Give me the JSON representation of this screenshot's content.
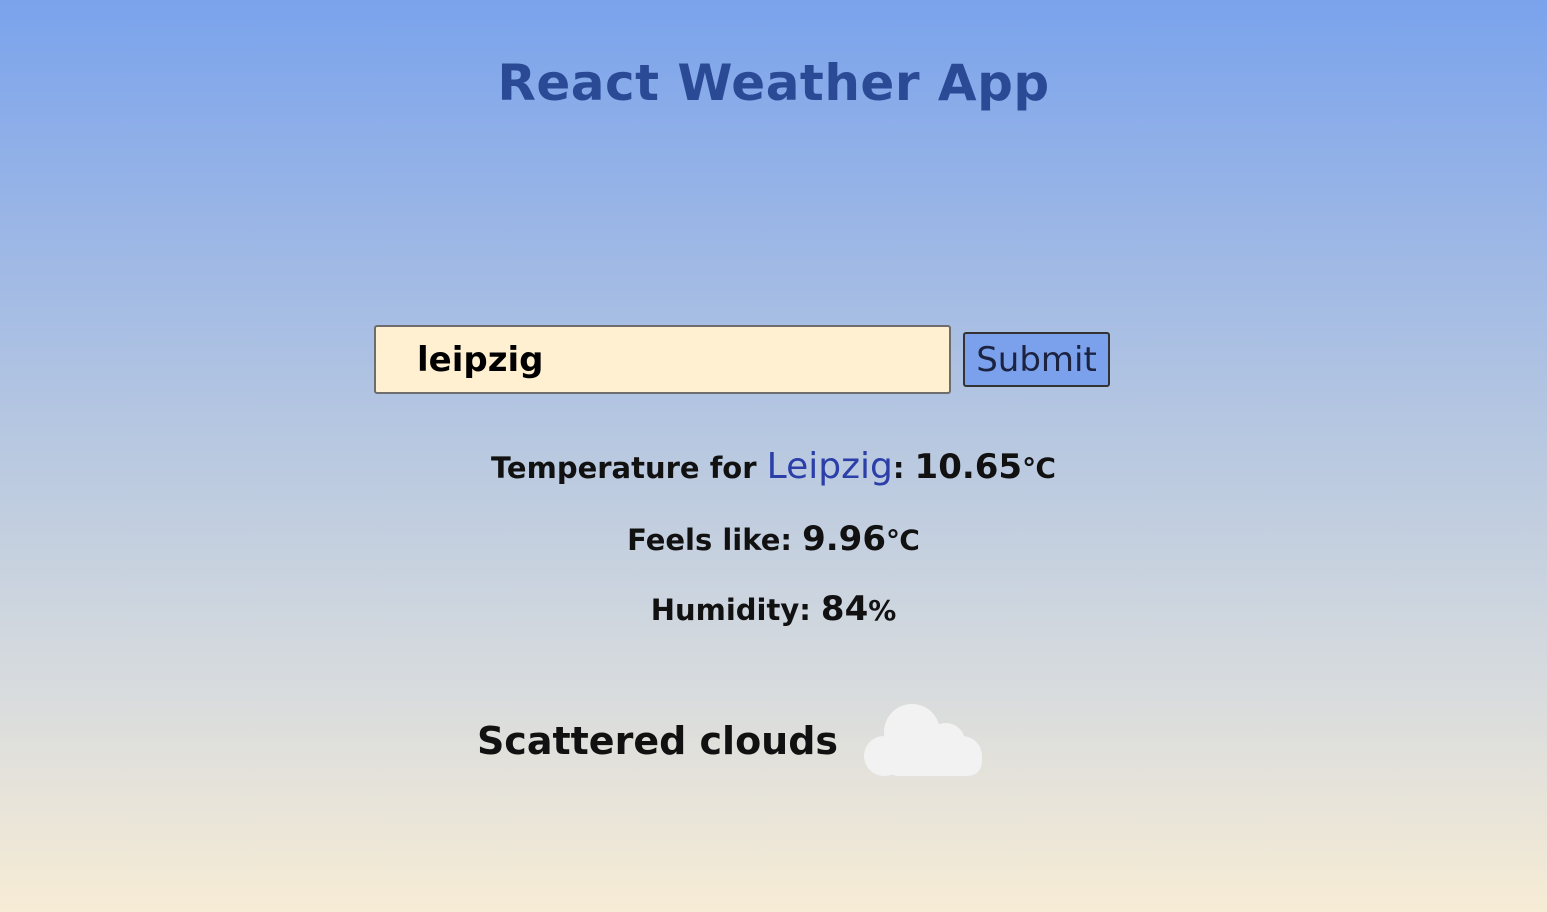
{
  "header": {
    "title": "React Weather App"
  },
  "search": {
    "value": "leipzig",
    "submit_label": "Submit"
  },
  "weather": {
    "temperature_label": "Temperature for ",
    "city": "Leipzig",
    "temperature_separator": ": ",
    "temperature_value": "10.65",
    "temperature_unit": "℃",
    "feels_like_label": "Feels like: ",
    "feels_like_value": "9.96",
    "feels_like_unit": "℃",
    "humidity_label": "Humidity: ",
    "humidity_value": "84",
    "humidity_unit": "%",
    "description": "Scattered clouds",
    "icon": "cloud-icon"
  },
  "colors": {
    "title": "#2b4a96",
    "city": "#2c3fa8",
    "input_background": "#fff0d1",
    "button_background": "#7ba0ec",
    "gradient_top": "#7aa3ec",
    "gradient_bottom": "#f7ecd5"
  }
}
